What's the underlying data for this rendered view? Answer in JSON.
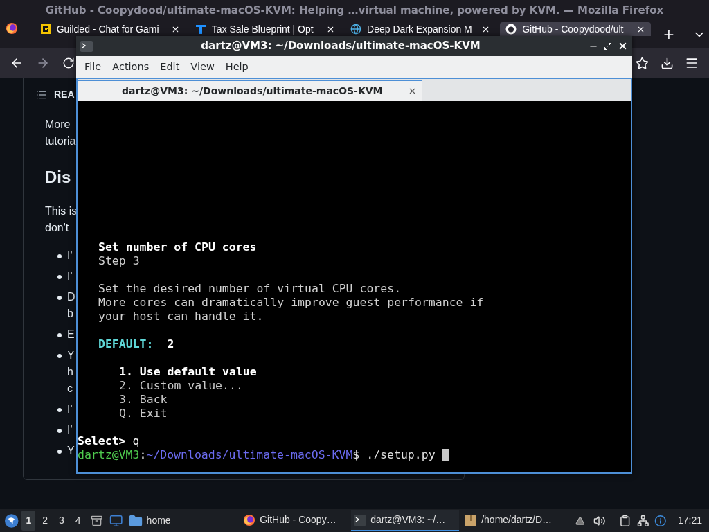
{
  "browser": {
    "window_title": "GitHub - Coopydood/ultimate-macOS-KVM: Helping …virtual machine, powered by KVM. — Mozilla Firefox",
    "tabs": [
      {
        "label": "Guilded - Chat for Gami",
        "selected": false
      },
      {
        "label": "Tax Sale Blueprint | Opt",
        "selected": false
      },
      {
        "label": "Deep Dark Expansion M",
        "selected": false
      },
      {
        "label": "GitHub - Coopydood/ult",
        "selected": true
      }
    ],
    "readme": {
      "header": "REA",
      "blocks": [
        {
          "kind": "para",
          "lines": [
            "More",
            "tutoria"
          ]
        },
        {
          "kind": "heading",
          "lines": [
            "Dis"
          ]
        },
        {
          "kind": "para",
          "lines": [
            "This is",
            "don't"
          ]
        },
        {
          "kind": "bullet",
          "lines": [
            "I'"
          ]
        },
        {
          "kind": "bullet",
          "lines": [
            "I'"
          ]
        },
        {
          "kind": "bullet",
          "lines": [
            "D",
            "b"
          ]
        },
        {
          "kind": "bullet",
          "lines": [
            "E"
          ]
        },
        {
          "kind": "bullet",
          "lines": [
            "Y",
            "h",
            "c"
          ]
        },
        {
          "kind": "bullet",
          "lines": [
            "I'"
          ]
        },
        {
          "kind": "bullet",
          "lines": [
            "I'"
          ]
        },
        {
          "kind": "bullet",
          "lines": [
            "Y"
          ]
        }
      ]
    }
  },
  "terminal": {
    "title": "dartz@VM3: ~/Downloads/ultimate-macOS-KVM",
    "menu": [
      "File",
      "Actions",
      "Edit",
      "View",
      "Help"
    ],
    "tab": "dartz@VM3: ~/Downloads/ultimate-macOS-KVM",
    "heading": "Set number of CPU cores",
    "step": "Step 3",
    "description": [
      "Set the desired number of virtual CPU cores.",
      "More cores can dramatically improve guest performance if",
      "your host can handle it."
    ],
    "default_label": "DEFAULT:",
    "default_value": "2",
    "options": [
      {
        "label": "1. Use default value",
        "selected": true
      },
      {
        "label": "2. Custom value...",
        "selected": false
      },
      {
        "label": "3. Back",
        "selected": false
      },
      {
        "label": "Q. Exit",
        "selected": false
      }
    ],
    "select_prompt": "Select>",
    "select_input": "q",
    "prompt_user": "dartz@VM3",
    "prompt_sep": ":",
    "prompt_path": "~/Downloads/ultimate-macOS-KVM",
    "prompt_command": "$ ./setup.py"
  },
  "taskbar": {
    "workspaces": [
      {
        "label": "1",
        "selected": true
      },
      {
        "label": "2",
        "selected": false
      },
      {
        "label": "3",
        "selected": false
      },
      {
        "label": "4",
        "selected": false
      }
    ],
    "launcher": "home",
    "tasks": [
      {
        "label": "GitHub - Coopy…",
        "selected": false
      },
      {
        "label": "dartz@VM3: ~/…",
        "selected": true
      },
      {
        "label": "/home/dartz/D…",
        "selected": false
      }
    ],
    "clock": "17:21"
  }
}
